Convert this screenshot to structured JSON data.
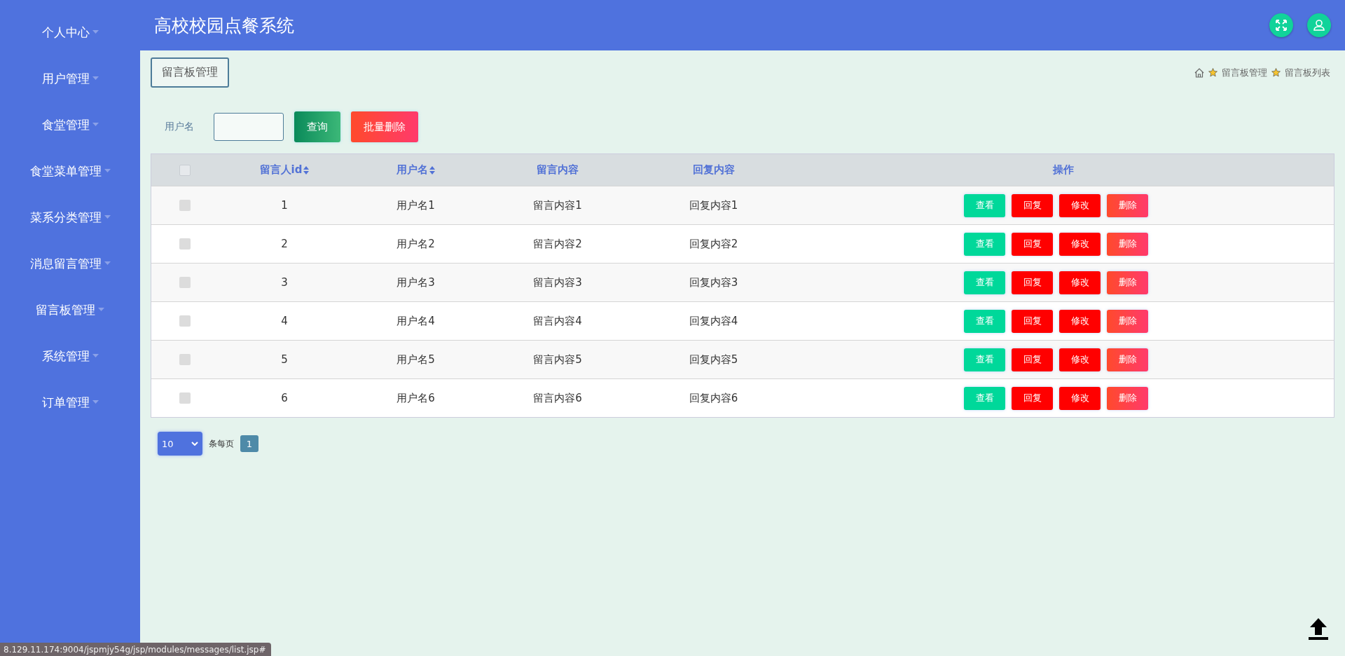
{
  "sidebar": {
    "items": [
      {
        "label": "个人中心"
      },
      {
        "label": "用户管理"
      },
      {
        "label": "食堂管理"
      },
      {
        "label": "食堂菜单管理"
      },
      {
        "label": "菜系分类管理"
      },
      {
        "label": "消息留言管理"
      },
      {
        "label": "留言板管理"
      },
      {
        "label": "系统管理"
      },
      {
        "label": "订单管理"
      }
    ]
  },
  "header": {
    "title": "高校校园点餐系统"
  },
  "page_tab": "留言板管理",
  "breadcrumb": [
    "留言板管理",
    "留言板列表"
  ],
  "search": {
    "label": "用户名",
    "buttons": [
      {
        "label": "查询",
        "kind": "search"
      },
      {
        "label": "批量删除",
        "kind": "delete"
      }
    ]
  },
  "table": {
    "header_checked": false,
    "columns": [
      {
        "label": "留言人id",
        "sortable": true
      },
      {
        "label": "用户名",
        "sortable": true
      },
      {
        "label": "留言内容",
        "sortable": false
      },
      {
        "label": "回复内容",
        "sortable": false
      },
      {
        "label": "操作",
        "sortable": false
      }
    ],
    "rows": [
      {
        "checked": false,
        "cells": [
          "1",
          "用户名1",
          "留言内容1",
          "回复内容1"
        ],
        "actions": [
          {
            "label": "查看",
            "kind": "view"
          },
          {
            "label": "回复",
            "kind": "reply"
          },
          {
            "label": "修改",
            "kind": "edit"
          },
          {
            "label": "删除",
            "kind": "delete"
          }
        ]
      },
      {
        "checked": false,
        "cells": [
          "2",
          "用户名2",
          "留言内容2",
          "回复内容2"
        ],
        "actions": [
          {
            "label": "查看",
            "kind": "view"
          },
          {
            "label": "回复",
            "kind": "reply"
          },
          {
            "label": "修改",
            "kind": "edit"
          },
          {
            "label": "删除",
            "kind": "delete"
          }
        ]
      },
      {
        "checked": false,
        "cells": [
          "3",
          "用户名3",
          "留言内容3",
          "回复内容3"
        ],
        "actions": [
          {
            "label": "查看",
            "kind": "view"
          },
          {
            "label": "回复",
            "kind": "reply"
          },
          {
            "label": "修改",
            "kind": "edit"
          },
          {
            "label": "删除",
            "kind": "delete"
          }
        ]
      },
      {
        "checked": false,
        "cells": [
          "4",
          "用户名4",
          "留言内容4",
          "回复内容4"
        ],
        "actions": [
          {
            "label": "查看",
            "kind": "view"
          },
          {
            "label": "回复",
            "kind": "reply"
          },
          {
            "label": "修改",
            "kind": "edit"
          },
          {
            "label": "删除",
            "kind": "delete"
          }
        ]
      },
      {
        "checked": false,
        "cells": [
          "5",
          "用户名5",
          "留言内容5",
          "回复内容5"
        ],
        "actions": [
          {
            "label": "查看",
            "kind": "view"
          },
          {
            "label": "回复",
            "kind": "reply"
          },
          {
            "label": "修改",
            "kind": "edit"
          },
          {
            "label": "删除",
            "kind": "delete"
          }
        ]
      },
      {
        "checked": false,
        "cells": [
          "6",
          "用户名6",
          "留言内容6",
          "回复内容6"
        ],
        "actions": [
          {
            "label": "查看",
            "kind": "view"
          },
          {
            "label": "回复",
            "kind": "reply"
          },
          {
            "label": "修改",
            "kind": "edit"
          },
          {
            "label": "删除",
            "kind": "delete"
          }
        ]
      }
    ]
  },
  "pagination": {
    "page_size": "10",
    "page_size_label": "条每页",
    "pages": [
      {
        "label": "1",
        "selected": true
      }
    ]
  },
  "status_bar": "8.129.11.174:9004/jspmjy54g/jsp/modules/messages/list.jsp#"
}
